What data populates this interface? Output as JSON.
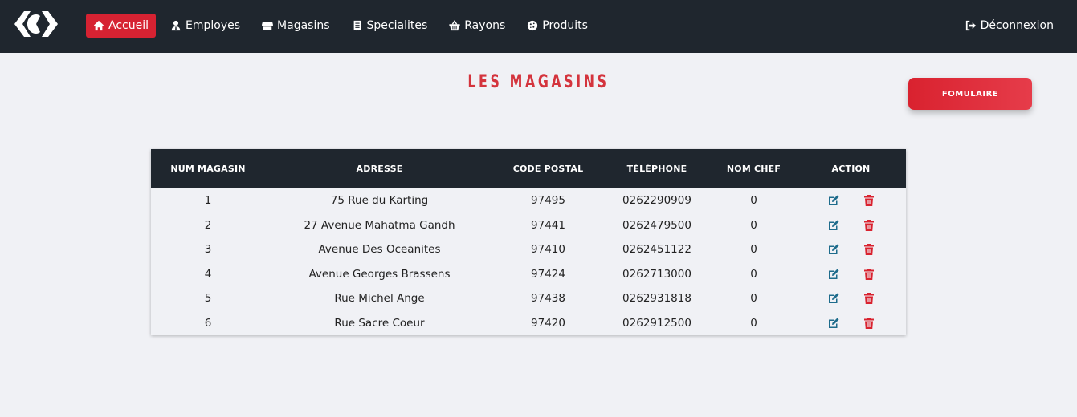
{
  "nav": {
    "items": [
      {
        "label": "Accueil",
        "icon": "home-icon",
        "active": true
      },
      {
        "label": "Employes",
        "icon": "user-tie-icon"
      },
      {
        "label": "Magasins",
        "icon": "store-icon"
      },
      {
        "label": "Specialites",
        "icon": "receipt-icon"
      },
      {
        "label": "Rayons",
        "icon": "basket-icon"
      },
      {
        "label": "Produits",
        "icon": "cookie-icon"
      }
    ],
    "logout_label": "Déconnexion"
  },
  "page": {
    "title": "LES MAGASINS",
    "form_button": "FOMULAIRE"
  },
  "table": {
    "headers": [
      "NUM MAGASIN",
      "ADRESSE",
      "CODE POSTAL",
      "TÉLÉPHONE",
      "NOM CHEF",
      "ACTION"
    ],
    "rows": [
      {
        "num": "1",
        "adresse": "75 Rue du Karting",
        "code": "97495",
        "tel": "0262290909",
        "chef": "0"
      },
      {
        "num": "2",
        "adresse": "27 Avenue Mahatma Gandh",
        "code": "97441",
        "tel": "0262479500",
        "chef": "0"
      },
      {
        "num": "3",
        "adresse": "Avenue Des Oceanites",
        "code": "97410",
        "tel": "0262451122",
        "chef": "0"
      },
      {
        "num": "4",
        "adresse": "Avenue Georges Brassens",
        "code": "97424",
        "tel": "0262713000",
        "chef": "0"
      },
      {
        "num": "5",
        "adresse": "Rue Michel Ange",
        "code": "97438",
        "tel": "0262931818",
        "chef": "0"
      },
      {
        "num": "6",
        "adresse": "Rue Sacre Coeur",
        "code": "97420",
        "tel": "0262912500",
        "chef": "0"
      }
    ]
  },
  "colors": {
    "navbar": "#1f262e",
    "accent_red": "#d62232",
    "edit_icon": "#1e6c8c",
    "delete_icon": "#d9222f"
  }
}
